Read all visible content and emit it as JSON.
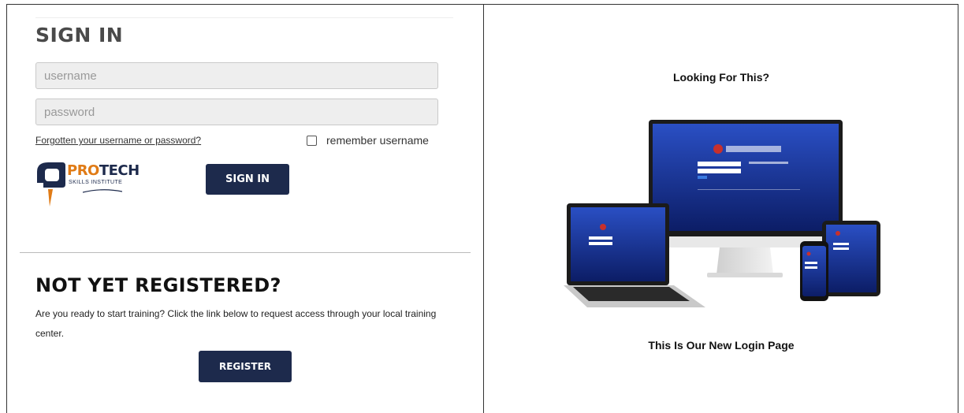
{
  "signin": {
    "title": "SIGN IN",
    "username_placeholder": "username",
    "password_placeholder": "password",
    "forgot_link": "Forgotten your username or password?",
    "remember_label": "remember username",
    "button_label": "SIGN IN"
  },
  "logo": {
    "brand_primary": "PRO",
    "brand_secondary": "TECH",
    "subtitle": "SKILLS INSTITUTE"
  },
  "register": {
    "title": "NOT YET REGISTERED?",
    "description": "Are you ready to start training? Click the link below to request access through your local training center.",
    "button_label": "REGISTER"
  },
  "promo": {
    "heading": "Looking For This?",
    "caption": "This Is Our New Login Page"
  },
  "colors": {
    "navy": "#1d2a4c",
    "orange": "#e07b16",
    "screen_blue": "#1a3fae"
  }
}
